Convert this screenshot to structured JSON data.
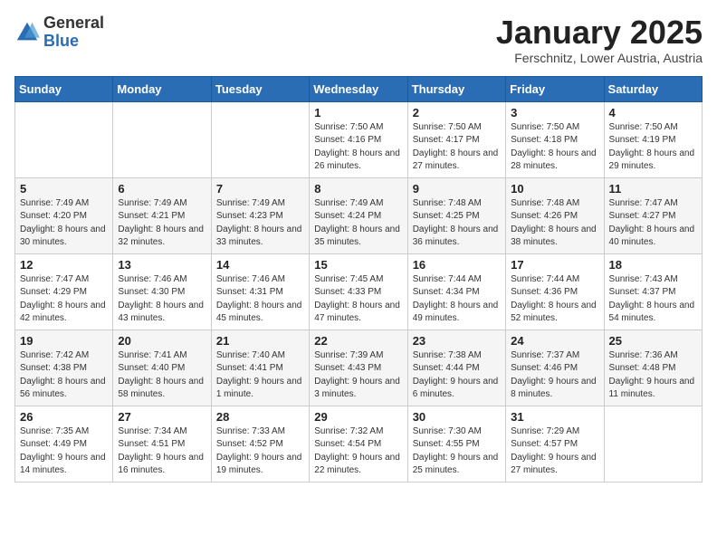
{
  "header": {
    "logo_general": "General",
    "logo_blue": "Blue",
    "month_title": "January 2025",
    "location": "Ferschnitz, Lower Austria, Austria"
  },
  "weekdays": [
    "Sunday",
    "Monday",
    "Tuesday",
    "Wednesday",
    "Thursday",
    "Friday",
    "Saturday"
  ],
  "weeks": [
    [
      {
        "day": "",
        "info": ""
      },
      {
        "day": "",
        "info": ""
      },
      {
        "day": "",
        "info": ""
      },
      {
        "day": "1",
        "info": "Sunrise: 7:50 AM\nSunset: 4:16 PM\nDaylight: 8 hours and 26 minutes."
      },
      {
        "day": "2",
        "info": "Sunrise: 7:50 AM\nSunset: 4:17 PM\nDaylight: 8 hours and 27 minutes."
      },
      {
        "day": "3",
        "info": "Sunrise: 7:50 AM\nSunset: 4:18 PM\nDaylight: 8 hours and 28 minutes."
      },
      {
        "day": "4",
        "info": "Sunrise: 7:50 AM\nSunset: 4:19 PM\nDaylight: 8 hours and 29 minutes."
      }
    ],
    [
      {
        "day": "5",
        "info": "Sunrise: 7:49 AM\nSunset: 4:20 PM\nDaylight: 8 hours and 30 minutes."
      },
      {
        "day": "6",
        "info": "Sunrise: 7:49 AM\nSunset: 4:21 PM\nDaylight: 8 hours and 32 minutes."
      },
      {
        "day": "7",
        "info": "Sunrise: 7:49 AM\nSunset: 4:23 PM\nDaylight: 8 hours and 33 minutes."
      },
      {
        "day": "8",
        "info": "Sunrise: 7:49 AM\nSunset: 4:24 PM\nDaylight: 8 hours and 35 minutes."
      },
      {
        "day": "9",
        "info": "Sunrise: 7:48 AM\nSunset: 4:25 PM\nDaylight: 8 hours and 36 minutes."
      },
      {
        "day": "10",
        "info": "Sunrise: 7:48 AM\nSunset: 4:26 PM\nDaylight: 8 hours and 38 minutes."
      },
      {
        "day": "11",
        "info": "Sunrise: 7:47 AM\nSunset: 4:27 PM\nDaylight: 8 hours and 40 minutes."
      }
    ],
    [
      {
        "day": "12",
        "info": "Sunrise: 7:47 AM\nSunset: 4:29 PM\nDaylight: 8 hours and 42 minutes."
      },
      {
        "day": "13",
        "info": "Sunrise: 7:46 AM\nSunset: 4:30 PM\nDaylight: 8 hours and 43 minutes."
      },
      {
        "day": "14",
        "info": "Sunrise: 7:46 AM\nSunset: 4:31 PM\nDaylight: 8 hours and 45 minutes."
      },
      {
        "day": "15",
        "info": "Sunrise: 7:45 AM\nSunset: 4:33 PM\nDaylight: 8 hours and 47 minutes."
      },
      {
        "day": "16",
        "info": "Sunrise: 7:44 AM\nSunset: 4:34 PM\nDaylight: 8 hours and 49 minutes."
      },
      {
        "day": "17",
        "info": "Sunrise: 7:44 AM\nSunset: 4:36 PM\nDaylight: 8 hours and 52 minutes."
      },
      {
        "day": "18",
        "info": "Sunrise: 7:43 AM\nSunset: 4:37 PM\nDaylight: 8 hours and 54 minutes."
      }
    ],
    [
      {
        "day": "19",
        "info": "Sunrise: 7:42 AM\nSunset: 4:38 PM\nDaylight: 8 hours and 56 minutes."
      },
      {
        "day": "20",
        "info": "Sunrise: 7:41 AM\nSunset: 4:40 PM\nDaylight: 8 hours and 58 minutes."
      },
      {
        "day": "21",
        "info": "Sunrise: 7:40 AM\nSunset: 4:41 PM\nDaylight: 9 hours and 1 minute."
      },
      {
        "day": "22",
        "info": "Sunrise: 7:39 AM\nSunset: 4:43 PM\nDaylight: 9 hours and 3 minutes."
      },
      {
        "day": "23",
        "info": "Sunrise: 7:38 AM\nSunset: 4:44 PM\nDaylight: 9 hours and 6 minutes."
      },
      {
        "day": "24",
        "info": "Sunrise: 7:37 AM\nSunset: 4:46 PM\nDaylight: 9 hours and 8 minutes."
      },
      {
        "day": "25",
        "info": "Sunrise: 7:36 AM\nSunset: 4:48 PM\nDaylight: 9 hours and 11 minutes."
      }
    ],
    [
      {
        "day": "26",
        "info": "Sunrise: 7:35 AM\nSunset: 4:49 PM\nDaylight: 9 hours and 14 minutes."
      },
      {
        "day": "27",
        "info": "Sunrise: 7:34 AM\nSunset: 4:51 PM\nDaylight: 9 hours and 16 minutes."
      },
      {
        "day": "28",
        "info": "Sunrise: 7:33 AM\nSunset: 4:52 PM\nDaylight: 9 hours and 19 minutes."
      },
      {
        "day": "29",
        "info": "Sunrise: 7:32 AM\nSunset: 4:54 PM\nDaylight: 9 hours and 22 minutes."
      },
      {
        "day": "30",
        "info": "Sunrise: 7:30 AM\nSunset: 4:55 PM\nDaylight: 9 hours and 25 minutes."
      },
      {
        "day": "31",
        "info": "Sunrise: 7:29 AM\nSunset: 4:57 PM\nDaylight: 9 hours and 27 minutes."
      },
      {
        "day": "",
        "info": ""
      }
    ]
  ]
}
